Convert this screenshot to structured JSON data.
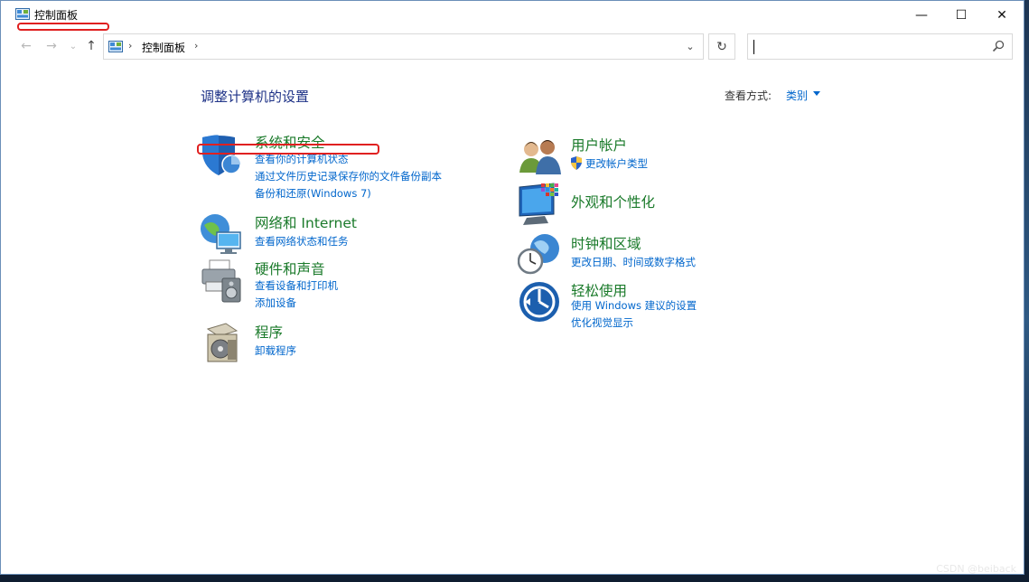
{
  "window": {
    "title": "控制面板"
  },
  "title_buttons": {
    "minimize": "—",
    "maximize": "☐",
    "close": "✕"
  },
  "nav": {
    "back": "←",
    "forward": "→",
    "recent": "⌄",
    "up": "↑"
  },
  "address": {
    "path": "控制面板",
    "sep1": "›",
    "sep2": "›",
    "dropdown": "⌄",
    "refresh": "↻"
  },
  "search": {
    "value": "",
    "placeholder": ""
  },
  "content": {
    "heading": "调整计算机的设置",
    "view_by_label": "查看方式:",
    "view_by_value": "类别"
  },
  "categories": [
    {
      "title": "系统和安全",
      "links": [
        "查看你的计算机状态",
        "通过文件历史记录保存你的文件备份副本",
        "备份和还原(Windows 7)"
      ]
    },
    {
      "title": "网络和 Internet",
      "links": [
        "查看网络状态和任务"
      ]
    },
    {
      "title": "硬件和声音",
      "links": [
        "查看设备和打印机",
        "添加设备"
      ]
    },
    {
      "title": "程序",
      "links": [
        "卸载程序"
      ]
    },
    {
      "title": "用户帐户",
      "links": [
        "更改帐户类型"
      ]
    },
    {
      "title": "外观和个性化",
      "links": []
    },
    {
      "title": "时钟和区域",
      "links": [
        "更改日期、时间或数字格式"
      ]
    },
    {
      "title": "轻松使用",
      "links": [
        "使用 Windows 建议的设置",
        "优化视觉显示"
      ]
    }
  ],
  "watermark": "CSDN @beiback",
  "colors": {
    "annotation": "#e02020",
    "category_title": "#1a7a2a",
    "link": "#0066cc",
    "heading": "#1e3287"
  }
}
